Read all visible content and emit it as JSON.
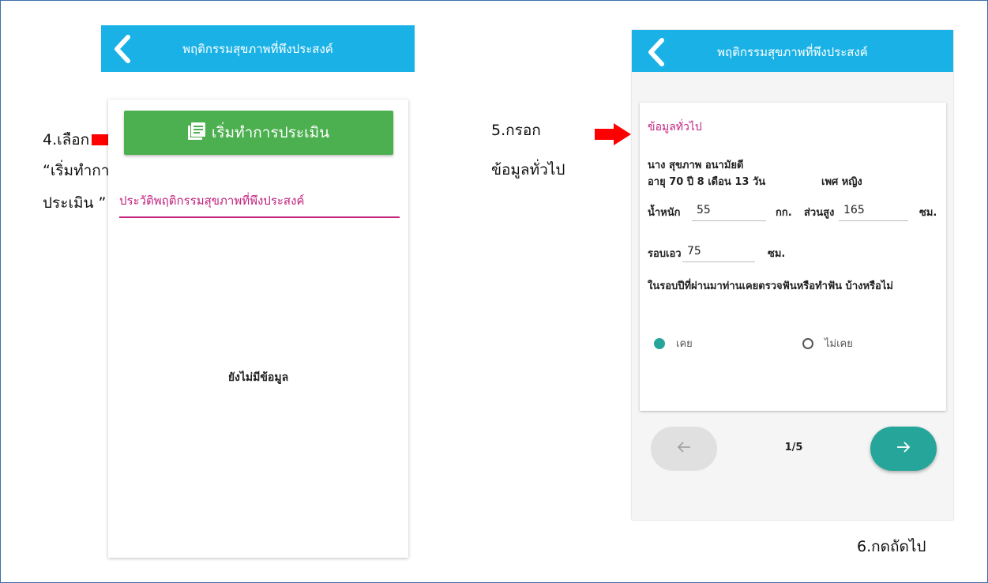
{
  "annotations": {
    "step4_line1": "4.เลือก",
    "step4_line2": "“เริ่มทำการ",
    "step4_line3": "ประเมิน ”",
    "step5_line1": "5.กรอก",
    "step5_line2": "ข้อมูลทั่วไป",
    "step6": "6.กดถัดไป"
  },
  "left_screen": {
    "header_title": "พฤติกรรมสุขภาพที่พึงประสงค์",
    "start_button_label": "เริ่มทำการประเมิน",
    "start_button_icon": "library-books-icon",
    "history_title": "ประวัติพฤติกรรมสุขภาพที่พึงประสงค์",
    "empty_text": "ยังไม่มีข้อมูล"
  },
  "right_screen": {
    "header_title": "พฤติกรรมสุขภาพที่พึงประสงค์",
    "section_title": "ข้อมูลทั่วไป",
    "person_name": "นาง สุขภาพ อนามัยดี",
    "age": "อายุ 70 ปี 8 เดือน 13 วัน",
    "gender": "เพศ หญิง",
    "weight_label": "น้ำหนัก",
    "weight_value": "55",
    "weight_unit": "กก.",
    "height_label": "ส่วนสูง",
    "height_value": "165",
    "height_unit": "ซม.",
    "waist_label": "รอบเอว",
    "waist_value": "75",
    "waist_unit": "ซม.",
    "question": "ในรอบปีที่ผ่านมาท่านเคยตรวจฟันหรือทำฟัน บ้างหรือไม่",
    "option_yes": "เคย",
    "option_no": "ไม่เคย",
    "selected_option": "เคย",
    "page_indicator": "1/5"
  },
  "colors": {
    "header": "#1ab2e6",
    "start_button": "#4caf50",
    "accent_magenta": "#c2237e",
    "teal": "#26a69a",
    "annotation_arrow": "#ff0000"
  }
}
